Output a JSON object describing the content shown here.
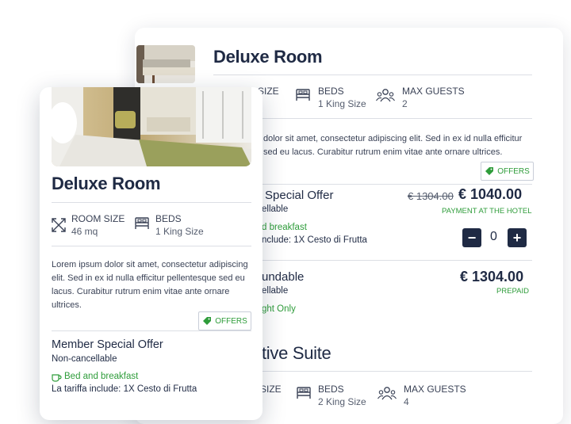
{
  "back_card": {
    "title": "Deluxe Room",
    "room_size_label_partial": "SIZE",
    "beds_label": "BEDS",
    "beds_value": "1 King Size",
    "max_guests_label": "MAX GUESTS",
    "max_guests_value": "2",
    "description_line1": "dolor sit amet, consectetur adipiscing elit. Sed in ex id nulla efficitur",
    "description_line2": "sed eu lacus. Curabitur rutrum enim vitae ante ornare ultrices.",
    "offers_label": "OFFERS",
    "offer1": {
      "name_partial": "Special Offer",
      "policy_partial": "ellable",
      "meal_partial": "d breakfast",
      "includes_partial": "nclude: 1X Cesto di Frutta",
      "old_price": "€ 1304.00",
      "price": "€ 1040.00",
      "payment_note": "PAYMENT AT THE HOTEL",
      "quantity": "0"
    },
    "offer2": {
      "name_partial": "undable",
      "policy_partial": "ellable",
      "meal_partial": "ght Only",
      "price": "€ 1304.00",
      "payment_note": "PREPAID"
    },
    "suite": {
      "title_partial": "tive Suite",
      "room_size_label_partial": "SIZE",
      "beds_label": "BEDS",
      "beds_value": "2 King Size",
      "max_guests_label": "MAX GUESTS",
      "max_guests_value": "4"
    }
  },
  "front_card": {
    "title": "Deluxe Room",
    "room_size_label": "ROOM SIZE",
    "room_size_value": "46 mq",
    "beds_label": "BEDS",
    "beds_value": "1 King Size",
    "description": "Lorem ipsum dolor sit amet, consectetur adipiscing elit. Sed in ex id nulla efficitur pellentesque sed eu lacus. Curabitur rutrum enim vitae ante ornare ultrices.",
    "offers_label": "OFFERS",
    "offer1": {
      "name": "Member Special Offer",
      "policy": "Non-cancellable",
      "meal": "Bed and breakfast",
      "includes": "La tariffa include: 1X Cesto di Frutta"
    }
  },
  "icons": [
    "expand-arrows-icon",
    "bed-icon",
    "guests-icon",
    "offer-tag-icon",
    "coffee-cup-icon",
    "minus-icon",
    "plus-icon"
  ],
  "colors": {
    "navy": "#1f2a44",
    "green": "#2e9c3a",
    "divider": "#dcdfe5"
  }
}
